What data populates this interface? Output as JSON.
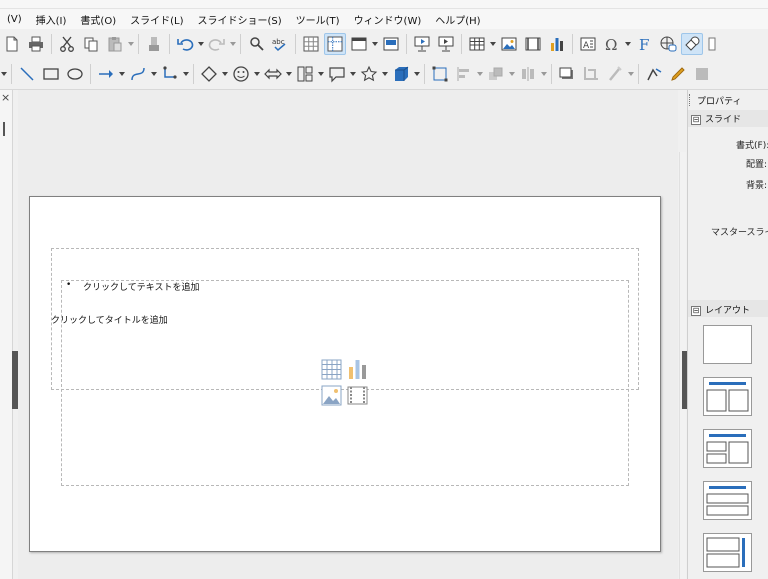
{
  "menu": {
    "items": [
      "(V)",
      "挿入(I)",
      "書式(O)",
      "スライド(L)",
      "スライドショー(S)",
      "ツール(T)",
      "ウィンドウ(W)",
      "ヘルプ(H)"
    ]
  },
  "left_pane": {
    "close_glyph": "×"
  },
  "slide": {
    "title_placeholder": "クリックしてタイトルを追加",
    "content_bullet": "•",
    "content_placeholder": "クリックしてテキストを追加"
  },
  "sidebar": {
    "panel_title": "プロパティ",
    "slide_section": "スライド",
    "format_label": "書式(F):",
    "orientation_label": "配置:",
    "background_label": "背景:",
    "master_label": "マスタースライド:",
    "layout_section": "レイアウト",
    "collapse_glyph": "⊟"
  },
  "colors": {
    "accent": "#2a6ebb",
    "active_bg": "#cfe4f7",
    "icon_gray": "#555555"
  }
}
